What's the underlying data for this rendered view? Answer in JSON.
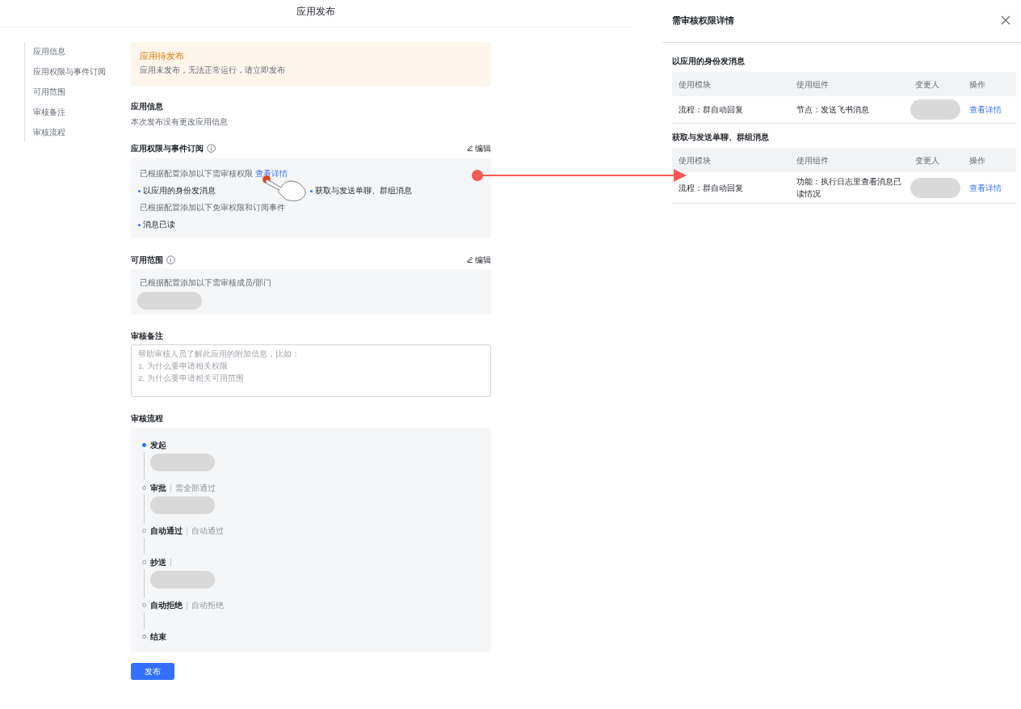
{
  "page_title": "应用发布",
  "sidebar": {
    "items": [
      "应用信息",
      "应用权限与事件订阅",
      "可用范围",
      "审核备注",
      "审核流程"
    ]
  },
  "banner": {
    "title": "应用待发布",
    "text": "应用未发布，无法正常运行，请立即发布"
  },
  "app_info": {
    "title": "应用信息",
    "text": "本次发布没有更改应用信息"
  },
  "permissions": {
    "title": "应用权限与事件订阅",
    "edit": "编辑",
    "review_text": "已根据配置添加以下需审核权限",
    "details_link": "查看详情",
    "review_items": [
      "以应用的身份发消息",
      "获取与发送单聊、群组消息"
    ],
    "free_text": "已根据配置添加以下免审权限和订阅事件",
    "free_items": [
      "消息已读"
    ]
  },
  "scope": {
    "title": "可用范围",
    "edit": "编辑",
    "text": "已根据配置添加以下需审核成员/部门",
    "member": {
      "kind": "blurred"
    }
  },
  "note": {
    "title": "审核备注",
    "placeholder": "帮助审核人员了解此应用的附加信息，比如：\n1. 为什么要申请相关权限\n2. 为什么要申请相关可用范围"
  },
  "flow": {
    "title": "审核流程",
    "steps": [
      {
        "label": "发起",
        "active": true,
        "assignee": {
          "kind": "blurred"
        }
      },
      {
        "label": "审批",
        "active": false,
        "divider": "|",
        "note": "需全部通过",
        "assignee": {
          "kind": "blurred"
        }
      },
      {
        "label": "自动通过",
        "active": false,
        "divider": "|",
        "note": "自动通过"
      },
      {
        "label": "抄送",
        "active": false,
        "divider": "|",
        "assignee": {
          "kind": "blurred"
        }
      },
      {
        "label": "自动拒绝",
        "active": false,
        "divider": "|",
        "note": "自动拒绝"
      },
      {
        "label": "结束",
        "active": false
      }
    ]
  },
  "publish_button": "发布",
  "drawer": {
    "title": "需审核权限详情",
    "sections": [
      {
        "title": "以应用的身份发消息",
        "columns": [
          "使用模块",
          "使用组件",
          "变更人",
          "操作"
        ],
        "rows": [
          {
            "module": "流程：群自动回复",
            "component": "节点：发送飞书消息",
            "changer": {
              "kind": "blurred"
            },
            "action": "查看详情"
          }
        ]
      },
      {
        "title": "获取与发送单聊、群组消息",
        "columns": [
          "使用模块",
          "使用组件",
          "变更人",
          "操作"
        ],
        "rows": [
          {
            "module": "流程：群自动回复",
            "component": "功能：执行日志里查看消息已读情况",
            "changer": {
              "kind": "blurred"
            },
            "action": "查看详情"
          }
        ]
      }
    ]
  }
}
